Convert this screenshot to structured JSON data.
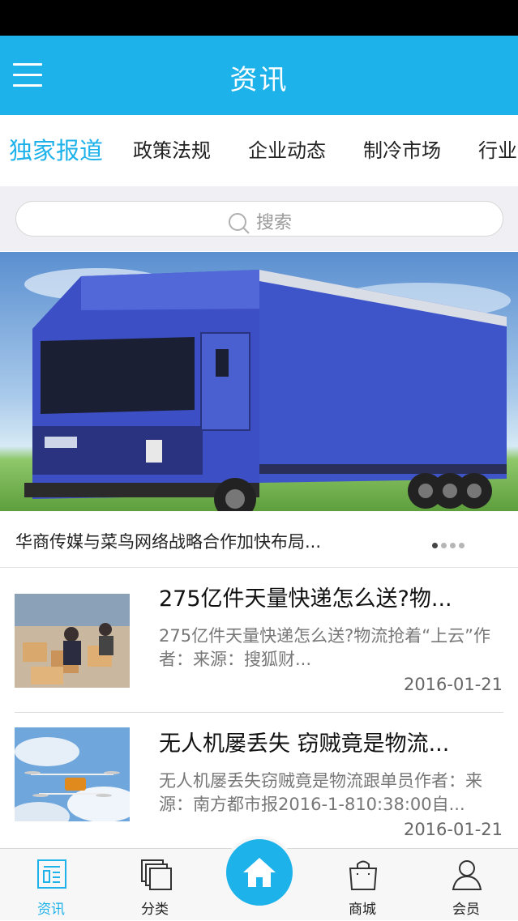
{
  "header": {
    "title": "资讯"
  },
  "tabs": [
    {
      "label": "独家报道",
      "active": true
    },
    {
      "label": "政策法规"
    },
    {
      "label": "企业动态"
    },
    {
      "label": "制冷市场"
    },
    {
      "label": "行业"
    }
  ],
  "search": {
    "placeholder": "搜索"
  },
  "banner": {
    "caption": "华商传媒与菜鸟网络战略合作加快布局...",
    "slide_count": 4,
    "active_slide": 1
  },
  "news": [
    {
      "title": "275亿件天量快递怎么送?物...",
      "summary": "275亿件天量快递怎么送?物流抢着“上云”作者：来源：搜狐财...",
      "date": "2016-01-21"
    },
    {
      "title": "无人机屡丢失 窃贼竟是物流...",
      "summary": "无人机屡丢失窃贼竟是物流跟单员作者：来源：南方都市报2016-1-810:38:00自...",
      "date": "2016-01-21"
    }
  ],
  "tabbar": [
    {
      "label": "资讯",
      "icon": "news-icon",
      "active": true
    },
    {
      "label": "分类",
      "icon": "category-icon"
    },
    {
      "label": "",
      "icon": "home-icon"
    },
    {
      "label": "商城",
      "icon": "shopping-bag-icon"
    },
    {
      "label": "会员",
      "icon": "user-icon"
    }
  ],
  "colors": {
    "accent": "#1eb2ea",
    "status_bar": "#000000",
    "text": "#222222",
    "muted": "#777777"
  }
}
